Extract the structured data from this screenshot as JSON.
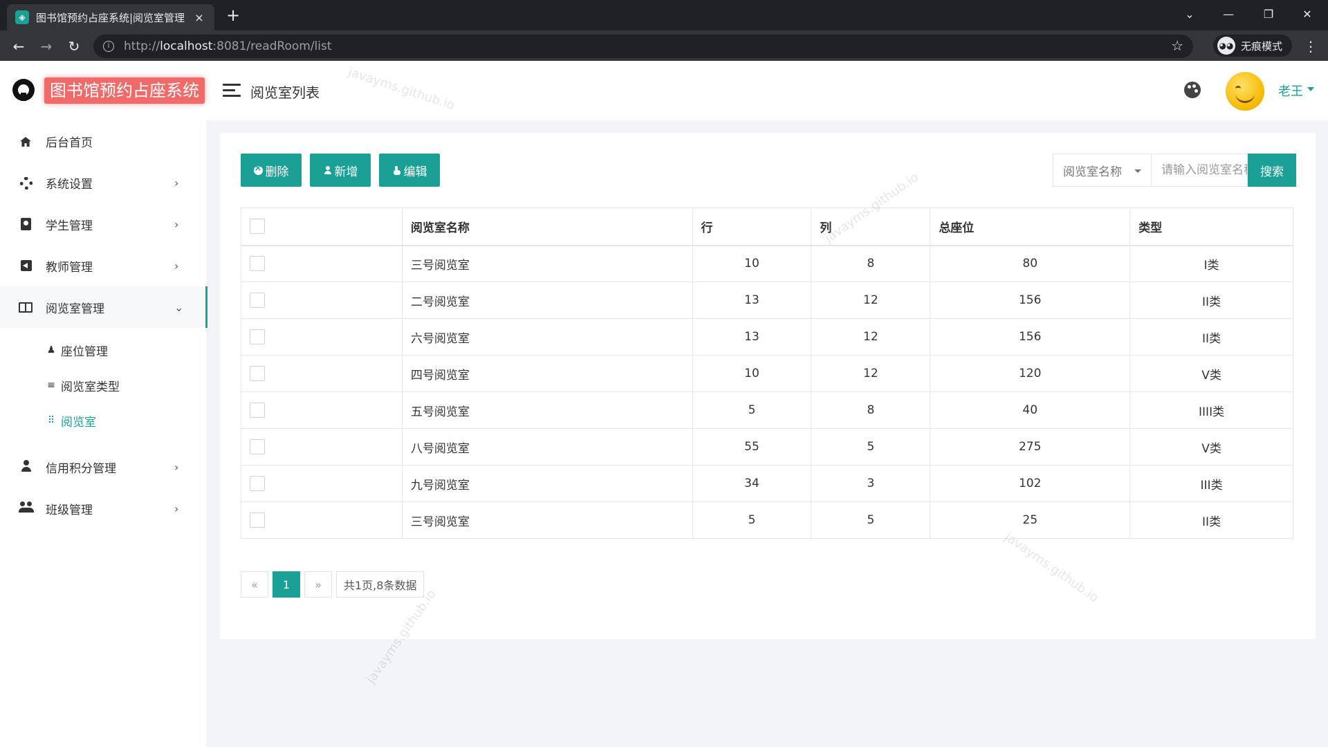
{
  "browser": {
    "tab_title": "图书馆预约占座系统|阅览室管理",
    "tab_close": "×",
    "new_tab": "+",
    "url_prefix": "http://",
    "url_host": "localhost",
    "url_rest": ":8081/readRoom/list",
    "incognito_label": "无痕模式",
    "controls": {
      "chevron": "⌄",
      "minimize": "—",
      "restore": "❐",
      "close": "✕"
    },
    "nav": {
      "back": "←",
      "forward": "→",
      "reload": "↻"
    }
  },
  "header": {
    "app_title": "图书馆预约占座系统",
    "page_title": "阅览室列表",
    "user_name": "老王",
    "logo_icon": "github-icon",
    "theme_icon": "palette-icon"
  },
  "sidebar": {
    "items": [
      {
        "label": "后台首页",
        "icon": "home-icon",
        "arrow": ""
      },
      {
        "label": "系统设置",
        "icon": "gear-icon",
        "arrow": "›"
      },
      {
        "label": "学生管理",
        "icon": "badge-icon",
        "arrow": "›"
      },
      {
        "label": "教师管理",
        "icon": "back-icon",
        "arrow": "›"
      },
      {
        "label": "阅览室管理",
        "icon": "book-icon",
        "arrow": "⌄"
      },
      {
        "label": "信用积分管理",
        "icon": "person-icon",
        "arrow": "›"
      },
      {
        "label": "班级管理",
        "icon": "people-icon",
        "arrow": "›"
      }
    ],
    "sub_items": [
      {
        "label": "座位管理",
        "icon": "♟"
      },
      {
        "label": "阅览室类型",
        "icon": "≡"
      },
      {
        "label": "阅览室",
        "icon": "⠿"
      }
    ]
  },
  "toolbar": {
    "delete_label": "删除",
    "add_label": "新增",
    "edit_label": "编辑",
    "search_field": "阅览室名称",
    "search_placeholder": "请输入阅览室名称",
    "search_button": "搜索"
  },
  "table": {
    "columns": [
      "阅览室名称",
      "行",
      "列",
      "总座位",
      "类型"
    ],
    "rows": [
      [
        "三号阅览室",
        "10",
        "8",
        "80",
        "I类"
      ],
      [
        "二号阅览室",
        "13",
        "12",
        "156",
        "II类"
      ],
      [
        "六号阅览室",
        "13",
        "12",
        "156",
        "II类"
      ],
      [
        "四号阅览室",
        "10",
        "12",
        "120",
        "V类"
      ],
      [
        "五号阅览室",
        "5",
        "8",
        "40",
        "IIII类"
      ],
      [
        "八号阅览室",
        "55",
        "5",
        "275",
        "V类"
      ],
      [
        "九号阅览室",
        "34",
        "3",
        "102",
        "III类"
      ],
      [
        "三号阅览室",
        "5",
        "5",
        "25",
        "II类"
      ]
    ]
  },
  "pagination": {
    "prev": "«",
    "current": "1",
    "next": "»",
    "summary": "共1页,8条数据"
  },
  "watermark": "javayms.github.io",
  "colors": {
    "accent": "#1aa094",
    "logo_bg": "#f06a6a"
  }
}
